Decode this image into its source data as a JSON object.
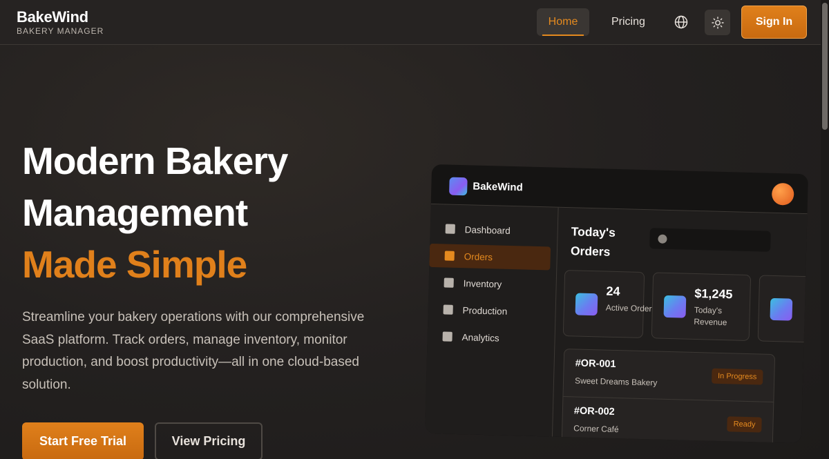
{
  "nav": {
    "brand_name": "BakeWind",
    "brand_sub": "BAKERY MANAGER",
    "home": "Home",
    "pricing": "Pricing",
    "globe_icon": "globe-icon",
    "theme_icon": "sun-icon",
    "sign_in": "Sign In"
  },
  "hero": {
    "title_line1": "Modern Bakery",
    "title_line2": "Management",
    "title_line3": "Made Simple",
    "description": "Streamline your bakery operations with our comprehensive SaaS platform. Track orders, manage inventory, monitor production, and boost productivity—all in one cloud-based solution.",
    "cta_primary": "Start Free Trial",
    "cta_secondary": "View Pricing"
  },
  "mockup": {
    "brand": "BakeWind",
    "sidebar": [
      {
        "label": "Dashboard",
        "active": false
      },
      {
        "label": "Orders",
        "active": true
      },
      {
        "label": "Inventory",
        "active": false
      },
      {
        "label": "Production",
        "active": false
      },
      {
        "label": "Analytics",
        "active": false
      }
    ],
    "title": "Today's Orders",
    "stats": [
      {
        "value": "24",
        "label": "Active Orders"
      },
      {
        "value": "$1,245",
        "label": "Today's Revenue"
      }
    ],
    "orders": [
      {
        "id": "#OR-001",
        "customer": "Sweet Dreams Bakery",
        "status": "In Progress"
      },
      {
        "id": "#OR-002",
        "customer": "Corner Café",
        "status": "Ready"
      }
    ]
  },
  "colors": {
    "accent": "#e0801b",
    "background": "#242120"
  }
}
